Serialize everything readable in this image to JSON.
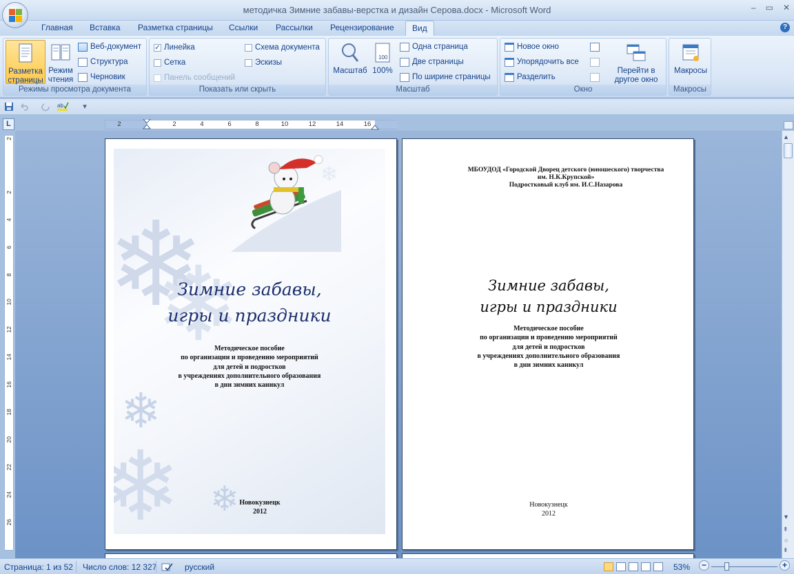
{
  "app": {
    "title": "методичка Зимние забавы-верстка и дизайн Серова.docx - Microsoft Word"
  },
  "window_controls": {
    "minimize": "‒",
    "restore": "▭",
    "close": "✕"
  },
  "tabs": [
    {
      "label": "Главная",
      "active": false
    },
    {
      "label": "Вставка",
      "active": false
    },
    {
      "label": "Разметка страницы",
      "active": false
    },
    {
      "label": "Ссылки",
      "active": false
    },
    {
      "label": "Рассылки",
      "active": false
    },
    {
      "label": "Рецензирование",
      "active": false
    },
    {
      "label": "Вид",
      "active": true
    }
  ],
  "help_label": "?",
  "ribbon": {
    "views": {
      "label": "Режимы просмотра документа",
      "page_layout": "Разметка страницы",
      "reading": "Режим чтения",
      "web": "Веб-документ",
      "outline": "Структура",
      "draft": "Черновик"
    },
    "show": {
      "label": "Показать или скрыть",
      "ruler": {
        "text": "Линейка",
        "checked": true
      },
      "grid": {
        "text": "Сетка",
        "checked": false
      },
      "message_bar": {
        "text": "Панель сообщений",
        "checked": false
      },
      "doc_map": {
        "text": "Схема документа",
        "checked": false
      },
      "thumbnails": {
        "text": "Эскизы",
        "checked": false
      },
      "check_mark": "✓"
    },
    "zoom": {
      "label": "Масштаб",
      "zoom": "Масштаб",
      "percent": "100%",
      "one_page": "Одна страница",
      "two_pages": "Две страницы",
      "page_width": "По ширине страницы"
    },
    "window": {
      "label": "Окно",
      "new_window": "Новое окно",
      "arrange_all": "Упорядочить все",
      "split": "Разделить",
      "switch": "Перейти в другое окно"
    },
    "macros": {
      "label": "Макросы",
      "macros": "Макросы"
    }
  },
  "qat": {
    "customize": "▾"
  },
  "ruler": {
    "corner": "L",
    "h_left": [
      "2"
    ],
    "h_right": [
      "2",
      "4",
      "6",
      "8",
      "10",
      "12",
      "14",
      "16"
    ],
    "v": [
      "2",
      "2",
      "4",
      "6",
      "8",
      "10",
      "12",
      "14",
      "16",
      "18",
      "20",
      "22",
      "24",
      "26"
    ]
  },
  "page1": {
    "title_line1": "Зимние забавы,",
    "title_line2": "игры и праздники",
    "sub": [
      "Методическое пособие",
      "по организации и проведению мероприятий",
      "для детей и подростков",
      "в учреждениях дополнительного образования",
      "в дни зимних каникул"
    ],
    "city": "Новокузнецк",
    "year": "2012"
  },
  "page2": {
    "header": [
      "МБОУДОД «Городской Дворец детского (юношеского) творчества",
      "им. Н.К.Крупской»",
      "Подростковый клуб им. И.С.Назарова"
    ],
    "title_line1": "Зимние забавы,",
    "title_line2": "игры и праздники",
    "sub": [
      "Методическое пособие",
      "по организации и проведению мероприятий",
      "для детей и подростков",
      "в учреждениях дополнительного образования",
      "в дни зимних каникул"
    ],
    "city": "Новокузнецк",
    "year": "2012"
  },
  "status": {
    "page": "Страница: 1 из 52",
    "words": "Число слов: 12 327",
    "lang": "русский",
    "zoom": "53%",
    "zoom_level_percent": 53,
    "zoom_minus": "−",
    "zoom_plus": "+"
  },
  "colors": {
    "accent": "#15428b",
    "ribbon": "#dbe7f6",
    "workspace": "#7f9fcf",
    "title_text": "#1b2f6e"
  }
}
